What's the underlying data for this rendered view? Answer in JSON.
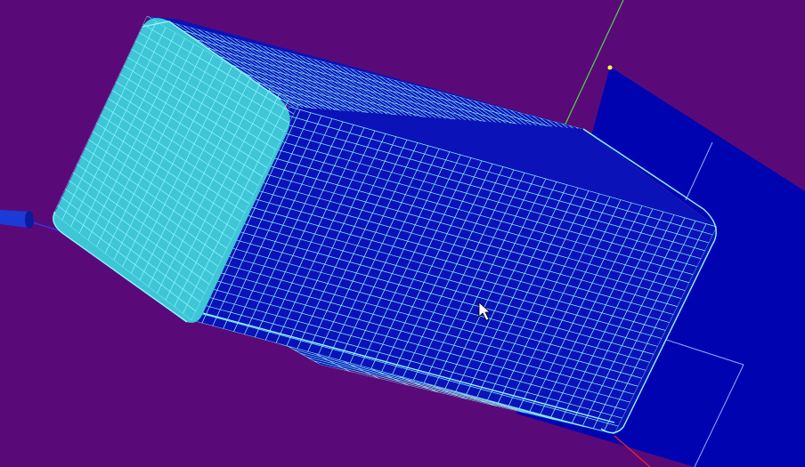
{
  "viewport": {
    "background": "#5a0a78",
    "label": ""
  },
  "palette": {
    "face_light": "#3ec6d6",
    "face_dark": "#0b12b8",
    "mesh_line": "#8ff8ff",
    "ground_plane": "#0004b0",
    "axis_green": "#49d84a",
    "axis_red": "#ff2020",
    "axis_blue": "#2a3cff",
    "cone": "#1c3ad6",
    "point_marker": "#ffff40"
  },
  "objects": [
    {
      "name": "meshed-box",
      "type": "rounded-rectangular-prism",
      "mesh": "structured-quad"
    },
    {
      "name": "ground-plane",
      "type": "plane"
    },
    {
      "name": "cone-glyph",
      "type": "cone"
    }
  ],
  "cursor": {
    "icon": "arrow-cursor-icon"
  }
}
